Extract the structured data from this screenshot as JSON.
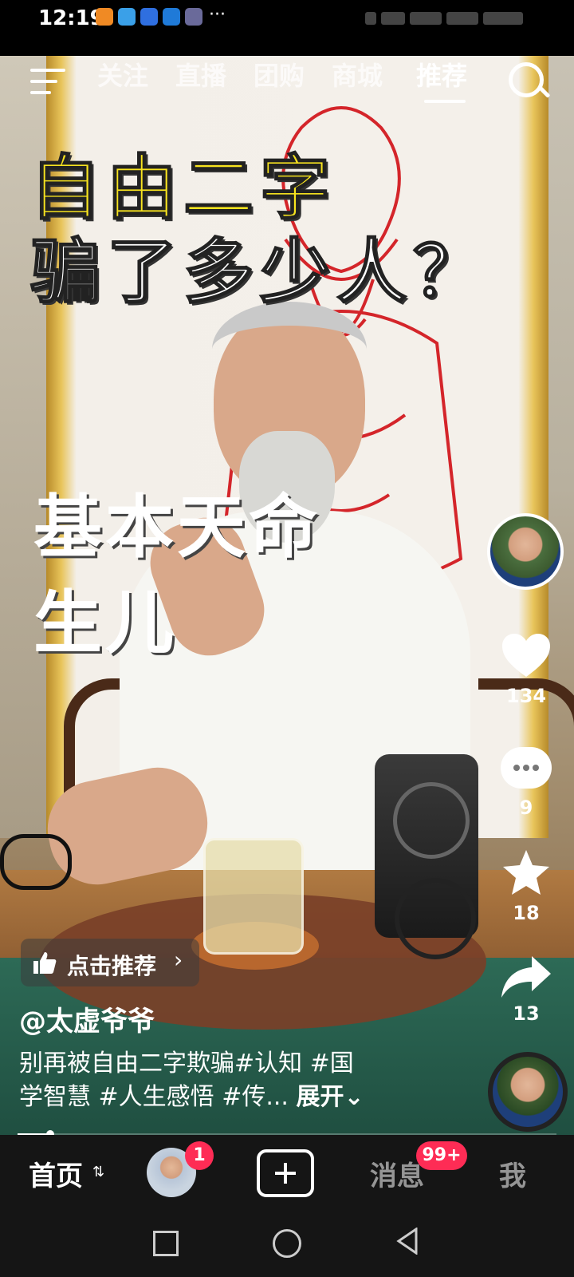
{
  "status_bar": {
    "time": "12:19",
    "more": "···"
  },
  "top_nav": {
    "tabs": [
      {
        "label": "关注",
        "active": false
      },
      {
        "label": "直播",
        "active": false
      },
      {
        "label": "团购",
        "active": false
      },
      {
        "label": "商城",
        "active": false
      },
      {
        "label": "推荐",
        "active": true
      }
    ]
  },
  "video": {
    "title_line1": "自由二字",
    "title_line2": "骗了多少人？",
    "subtitle_line1": "基本天命",
    "subtitle_line2": "生儿"
  },
  "right_rail": {
    "like_count": "134",
    "comment_count": "9",
    "favorite_count": "18",
    "share_count": "13"
  },
  "caption": {
    "recommend_label": "点击推荐",
    "author": "@太虚爷爷",
    "description_line1": "别再被自由二字欺骗#认知 #国",
    "description_line2": "学智慧 #人生感悟 #传...",
    "expand_label": "展开",
    "progress": 0.06
  },
  "tab_bar": {
    "home_label": "首页",
    "friends_badge": "1",
    "messages_label": "消息",
    "messages_badge": "99+",
    "me_label": "我"
  },
  "colors": {
    "title_yellow": "#f7e31f",
    "badge_red": "#fe2c55",
    "tab_bar_bg": "#151515"
  }
}
